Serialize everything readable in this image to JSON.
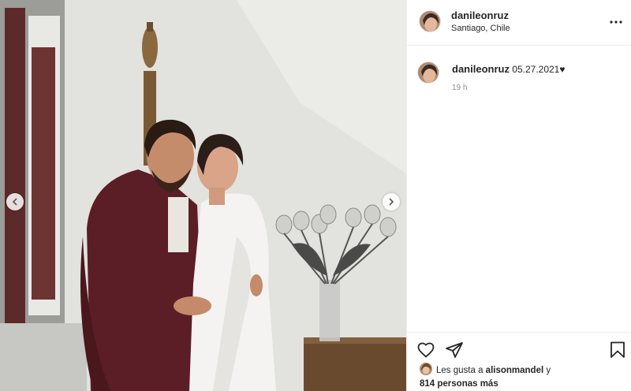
{
  "post": {
    "username": "danileonruz",
    "location": "Santiago, Chile"
  },
  "comment": {
    "username": "danileonruz",
    "caption": "05.27.2021♥",
    "time": "19 h"
  },
  "likes": {
    "prefix": "Les gusta a",
    "user": "alisonmandel",
    "connector": "y",
    "others": "814 personas más"
  },
  "icons": {
    "more": "more-options-icon",
    "like": "heart-icon",
    "share": "paper-plane-icon",
    "save": "bookmark-icon",
    "prev": "chevron-left-icon",
    "next": "chevron-right-icon"
  }
}
